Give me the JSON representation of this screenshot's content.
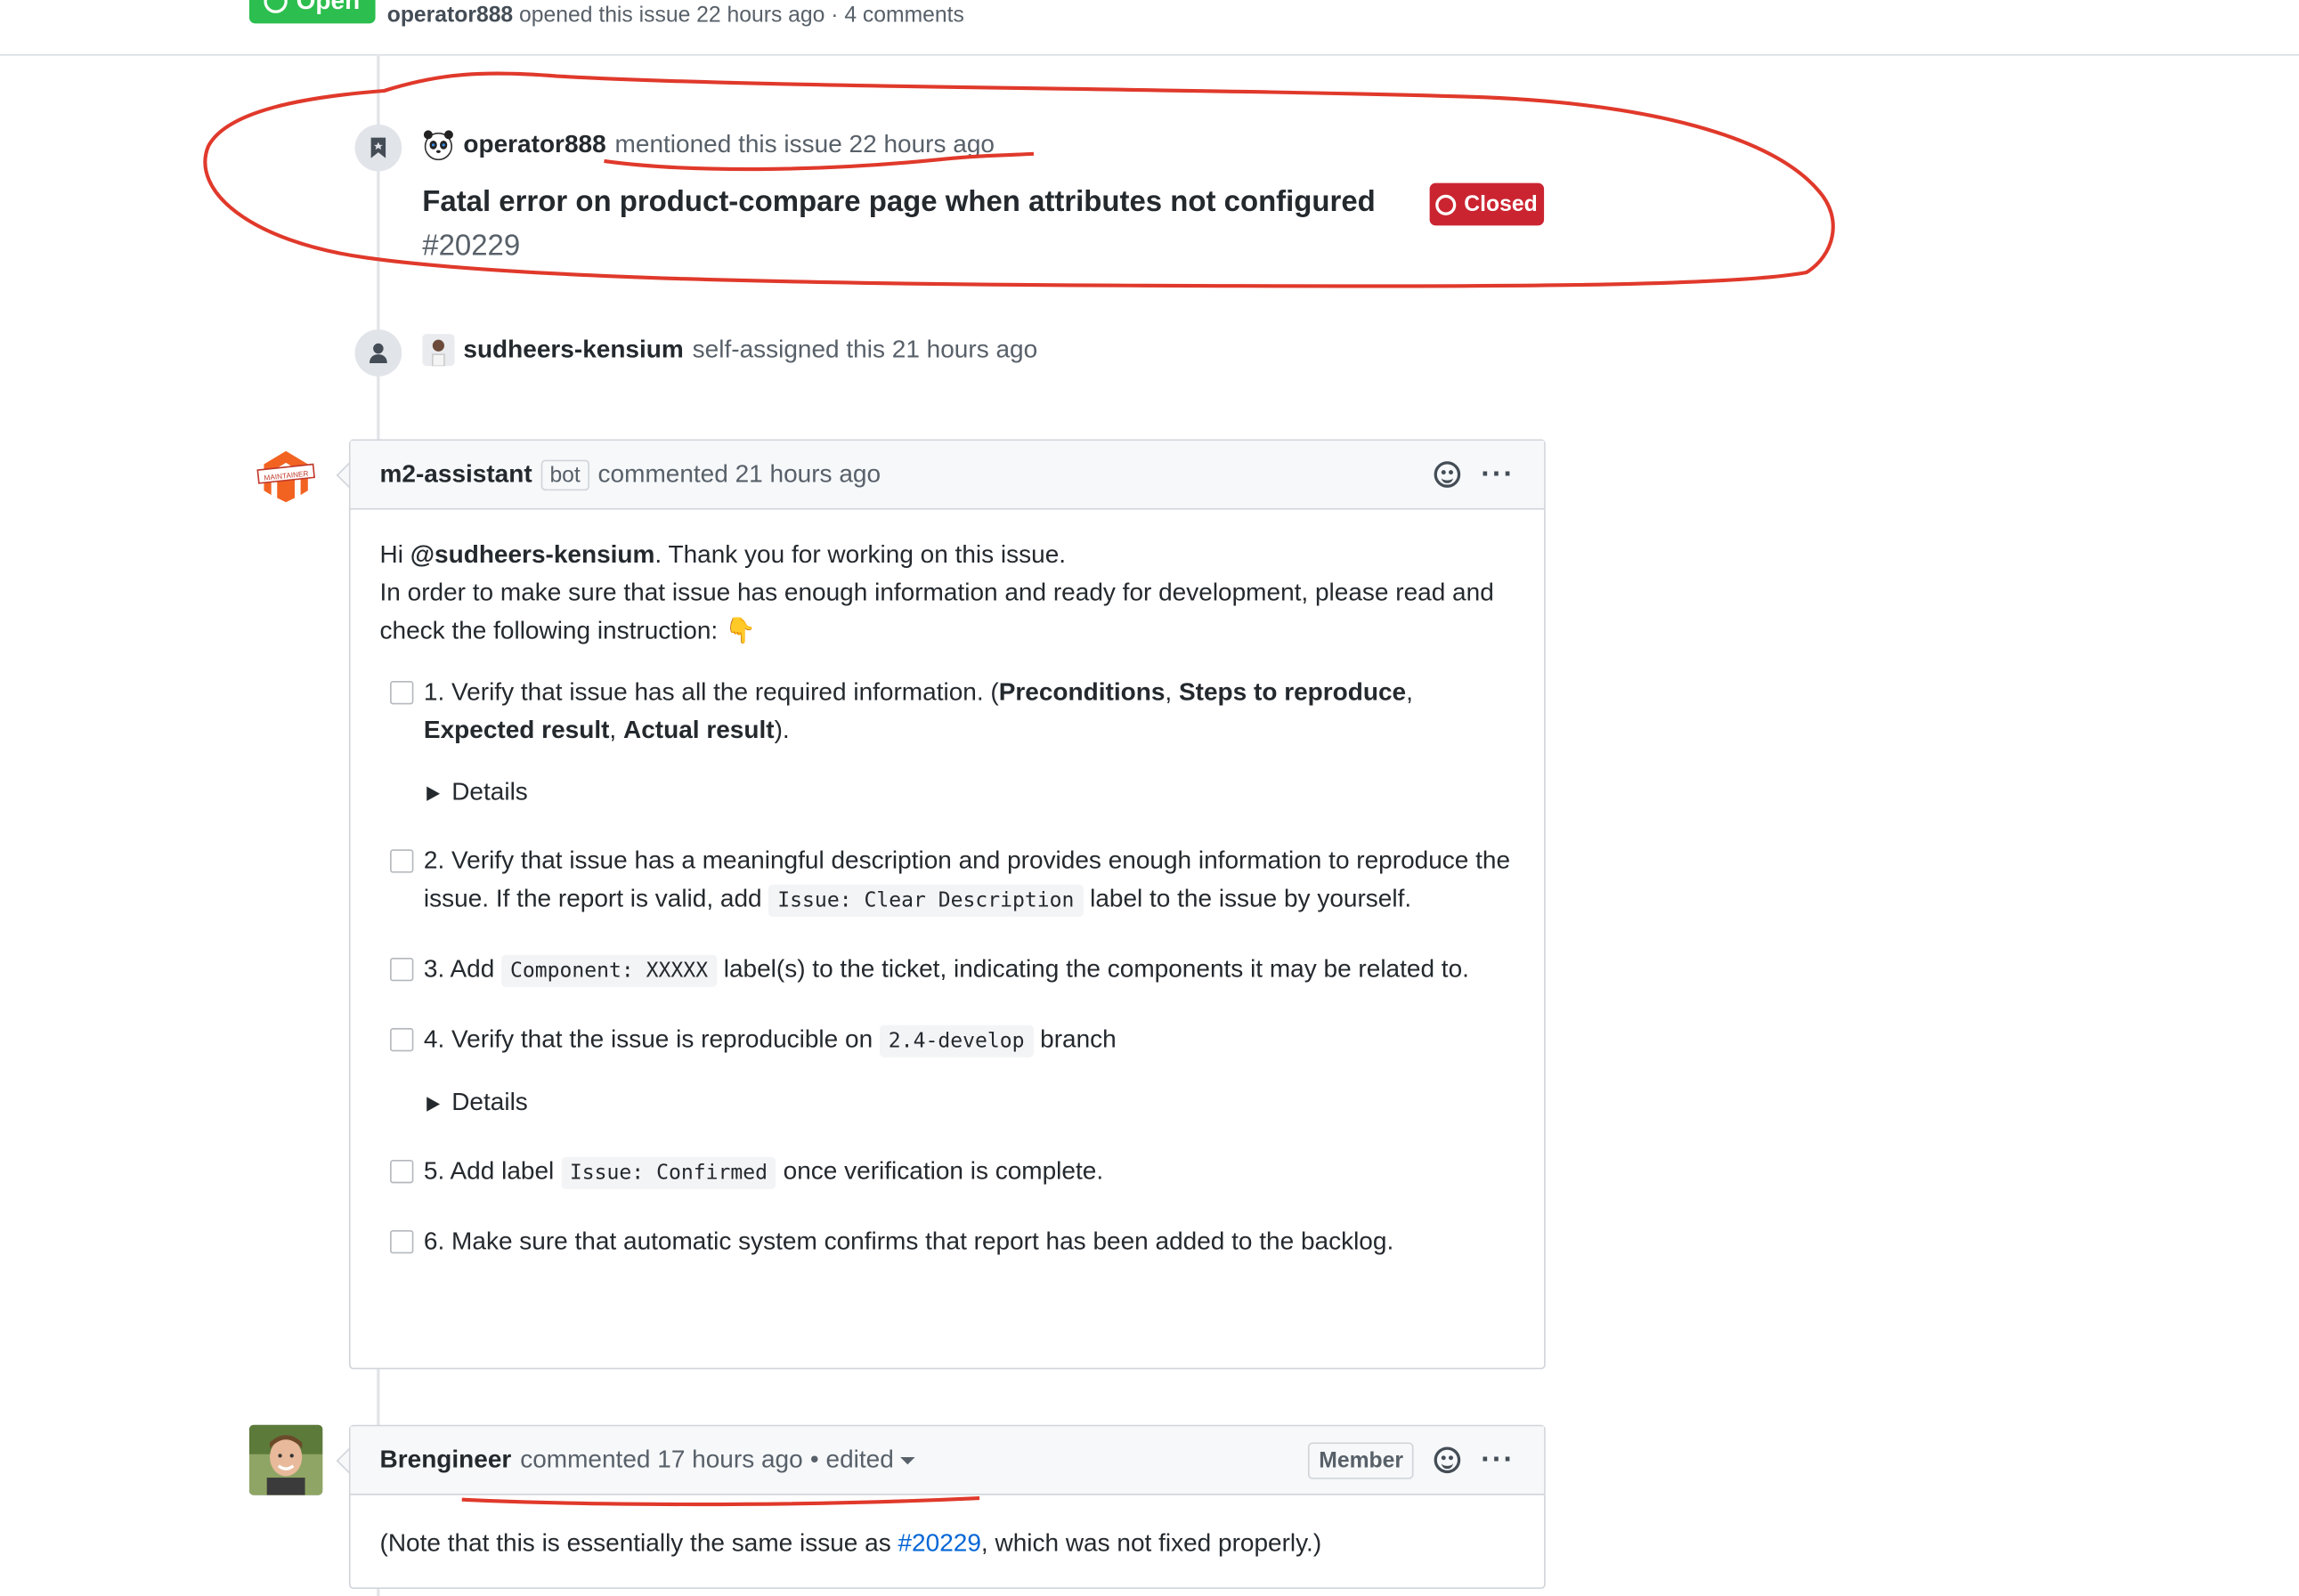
{
  "header": {
    "state": "Open",
    "author": "operator888",
    "meta": "opened this issue 22 hours ago · 4 comments"
  },
  "mention_event": {
    "actor": "operator888",
    "action": "mentioned this issue 22 hours ago",
    "ref_title": "Fatal error on product-compare page when attributes not configured",
    "ref_number": "#20229",
    "ref_state": "Closed"
  },
  "assign_event": {
    "actor": "sudheers-kensium",
    "action": "self-assigned this 21 hours ago"
  },
  "bot_comment": {
    "author": "m2-assistant",
    "label": "bot",
    "meta": "commented 21 hours ago",
    "avatar_label": "MAINTAINER",
    "greeting_prefix": "Hi ",
    "mention": "@sudheers-kensium",
    "greeting_suffix": ". Thank you for working on this issue.",
    "intro": "In order to make sure that issue has enough information and ready for development, please read and check the following instruction: 👇",
    "task1_prefix": "1. Verify that issue has all the required information. (",
    "task1_b1": "Preconditions",
    "task1_sep1": ", ",
    "task1_b2": "Steps to reproduce",
    "task1_sep2": ", ",
    "task1_b3": "Expected result",
    "task1_sep3": ", ",
    "task1_b4": "Actual result",
    "task1_suffix": ").",
    "details_label": "Details",
    "task2_prefix": "2. Verify that issue has a meaningful description and provides enough information to reproduce the issue. If the report is valid, add ",
    "task2_code": "Issue: Clear Description",
    "task2_suffix": " label to the issue by yourself.",
    "task3_prefix": "3. Add ",
    "task3_code": "Component: XXXXX",
    "task3_suffix": " label(s) to the ticket, indicating the components it may be related to.",
    "task4_prefix": "4. Verify that the issue is reproducible on ",
    "task4_code": "2.4-develop",
    "task4_suffix": " branch",
    "task5_prefix": "5. Add label ",
    "task5_code": "Issue: Confirmed",
    "task5_suffix": " once verification is complete.",
    "task6": "6. Make sure that automatic system confirms that report has been added to the backlog."
  },
  "member_comment": {
    "author": "Brengineer",
    "meta": "commented 17 hours ago",
    "edited": "• edited",
    "role_badge": "Member",
    "body_prefix": "(Note that this is essentially the same issue as ",
    "body_link": "#20229",
    "body_suffix": ", which was not fixed properly.)"
  },
  "icons": {
    "bookmark": "bookmark-icon",
    "person": "person-icon",
    "emoji": "smiley-icon",
    "more": "kebab-icon"
  },
  "colors": {
    "open_green": "#2cbe4e",
    "closed_red": "#cb2431",
    "link_blue": "#0366d6",
    "annotation_red": "#e0392b"
  }
}
